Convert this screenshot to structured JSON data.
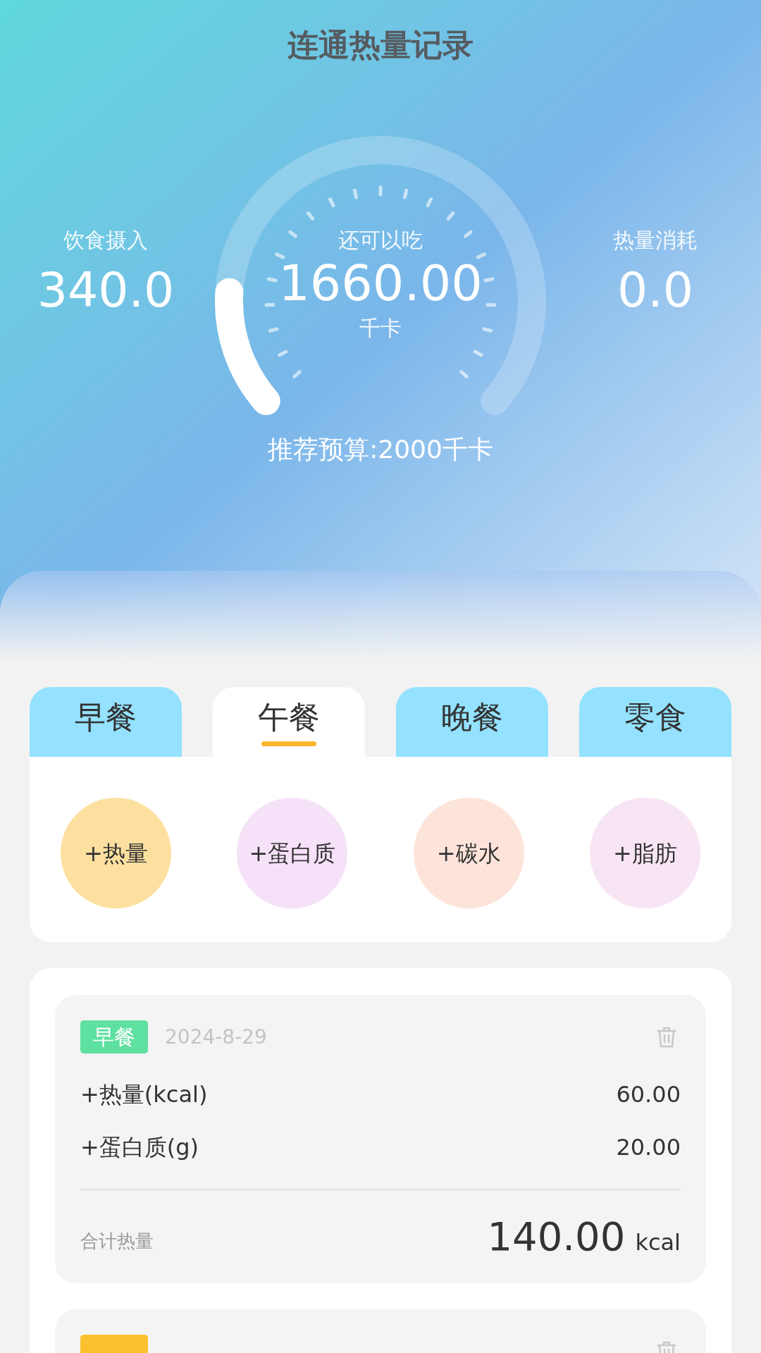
{
  "title": "连通热量记录",
  "stats": {
    "intake": {
      "label": "饮食摄入",
      "value": "340.0"
    },
    "remaining": {
      "label": "还可以吃",
      "value": "1660.00",
      "unit": "千卡",
      "level": 0.17
    },
    "burned": {
      "label": "热量消耗",
      "value": "0.0"
    }
  },
  "budget": "推荐预算:2000千卡",
  "tabs": [
    {
      "label": "早餐",
      "selected": false
    },
    {
      "label": "午餐",
      "selected": true
    },
    {
      "label": "晚餐",
      "selected": false
    },
    {
      "label": "零食",
      "selected": false
    }
  ],
  "nutrient_buttons": [
    {
      "label": "+热量",
      "color": "#fde0a0"
    },
    {
      "label": "+蛋白质",
      "color": "#f5e1f8"
    },
    {
      "label": "+碳水",
      "color": "#fde4da"
    },
    {
      "label": "+脂肪",
      "color": "#f8e5f4"
    }
  ],
  "records": [
    {
      "tag": "早餐",
      "color": "#5ee0a0",
      "date": "2024-8-29",
      "items": [
        {
          "label": "+热量(kcal)",
          "value": "60.00"
        },
        {
          "label": "+蛋白质(g)",
          "value": "20.00"
        }
      ],
      "total_label": "合计热量",
      "total_value": "140.00",
      "total_unit": "kcal"
    },
    {
      "color": "#fbc02d"
    }
  ]
}
